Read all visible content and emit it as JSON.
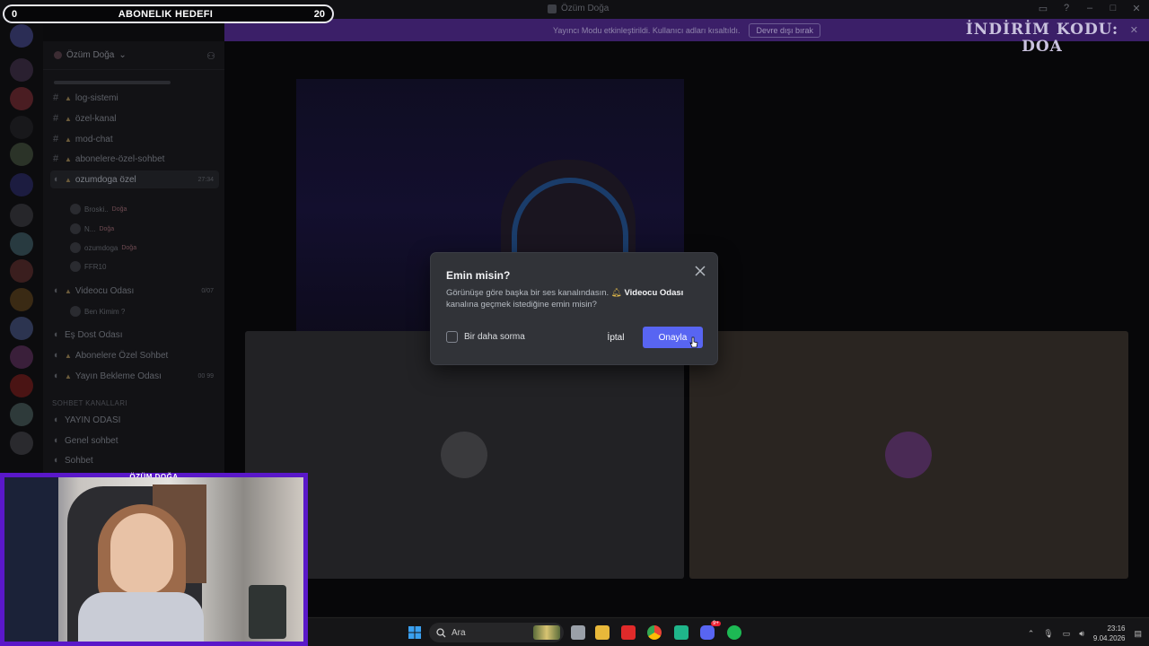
{
  "overlay": {
    "goal_title": "ABONELIK HEDEFI",
    "goal_current": "0",
    "goal_target": "20",
    "logo_line1": "İNDİRİM KODU:",
    "logo_line2": "DOA",
    "webcam_label": "ÖZÜM DOĞA"
  },
  "window": {
    "title": "Özüm Doğa"
  },
  "notice": {
    "text": "Yayıncı Modu etkinleştirildi. Kullanıcı adları kısaltıldı.",
    "button": "Devre dışı bırak"
  },
  "server": {
    "name": "Özüm Doğa"
  },
  "channels": [
    {
      "name": "log-sistemi",
      "type": "text"
    },
    {
      "name": "özel-kanal",
      "type": "text"
    },
    {
      "name": "mod-chat",
      "type": "text"
    },
    {
      "name": "abonelere-özel-sohbet",
      "type": "text"
    },
    {
      "name": "ozumdoga özel",
      "type": "voice",
      "count": "27:34"
    }
  ],
  "voice_users": [
    {
      "name": "Broski..",
      "tag": "Doğa"
    },
    {
      "name": "N...",
      "tag": "Doğa"
    },
    {
      "name": "ozumdoga",
      "tag": "Doğa"
    },
    {
      "name": "FFR10",
      "tag": ""
    }
  ],
  "channels2": [
    {
      "name": "Videocu Odası",
      "count": "0/07"
    },
    {
      "name": "Ben Kimim ?",
      "count": ""
    },
    {
      "name": "Eş Dost Odası",
      "count": ""
    },
    {
      "name": "Abonelere Özel Sohbet",
      "count": ""
    },
    {
      "name": "Yayın Bekleme Odası",
      "count": "00 99"
    }
  ],
  "category": "SOHBET KANALLARI",
  "channels3": [
    {
      "name": "YAYIN ODASI"
    },
    {
      "name": "Genel sohbet"
    },
    {
      "name": "Sohbet"
    }
  ],
  "modal": {
    "title": "Emin misin?",
    "body_prefix": "Görünüşe göre başka bir ses kanalındasın.",
    "channel_name": "Videocu Odası",
    "body_suffix": "kanalına geçmek istediğine emin misin?",
    "checkbox_label": "Bir daha sorma",
    "cancel_label": "İptal",
    "confirm_label": "Onayla"
  },
  "taskbar": {
    "search_placeholder": "Ara",
    "time": "23:16",
    "date": "9.04.2026",
    "discord_badge": "9+"
  },
  "colors": {
    "accent": "#5865f2",
    "notice_bg": "#3b1f68",
    "webcam_frame": "#5a18c9"
  }
}
